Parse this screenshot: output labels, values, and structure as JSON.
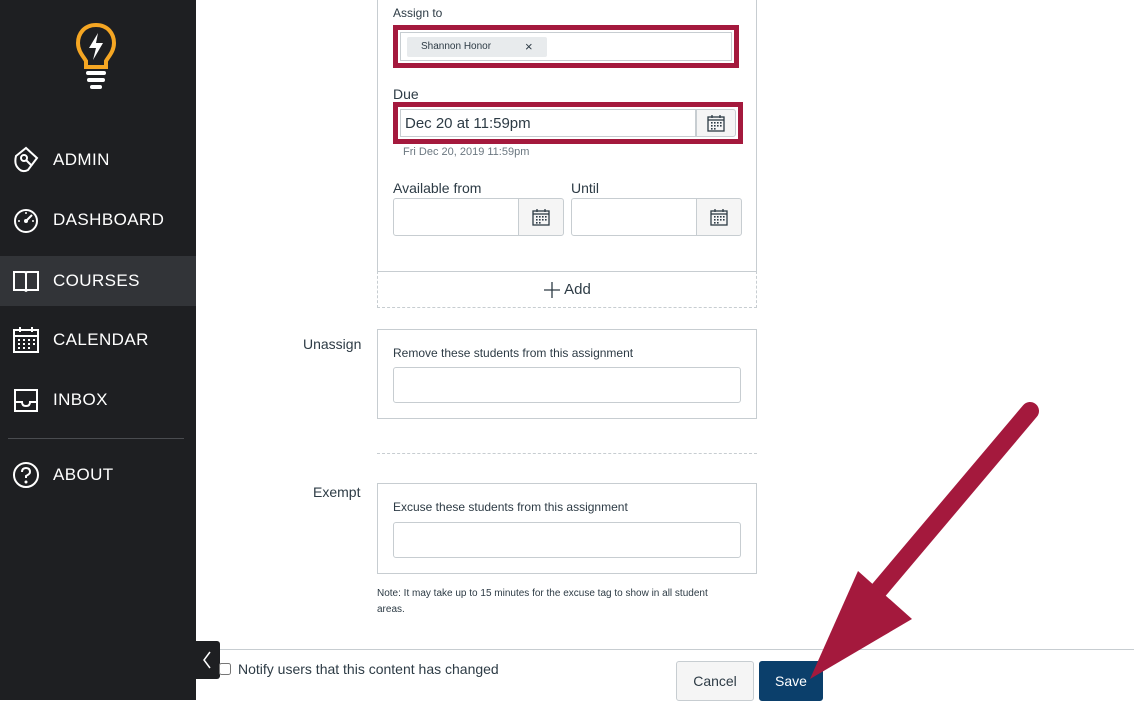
{
  "sidebar": {
    "items": [
      {
        "label": "ADMIN",
        "icon": "admin-shield-icon"
      },
      {
        "label": "DASHBOARD",
        "icon": "speedometer-icon"
      },
      {
        "label": "COURSES",
        "icon": "book-icon",
        "active": true
      },
      {
        "label": "CALENDAR",
        "icon": "calendar-icon"
      },
      {
        "label": "INBOX",
        "icon": "inbox-icon"
      },
      {
        "label": "ABOUT",
        "icon": "help-circle-icon"
      }
    ]
  },
  "assign": {
    "label": "Assign to",
    "token": "Shannon Honor",
    "token_remove": "×"
  },
  "due": {
    "label": "Due",
    "value": "Dec 20 at 11:59pm",
    "hint": "Fri Dec 20, 2019 11:59pm"
  },
  "available_from": {
    "label": "Available from",
    "value": ""
  },
  "until": {
    "label": "Until",
    "value": ""
  },
  "add_label": "Add",
  "unassign": {
    "label": "Unassign",
    "description": "Remove these students from this assignment"
  },
  "exempt": {
    "label": "Exempt",
    "description": "Excuse these students from this assignment",
    "note": "Note: It may take up to 15 minutes for the excuse tag to show in all student areas."
  },
  "notify_label": "Notify users that this content has changed",
  "buttons": {
    "cancel": "Cancel",
    "save": "Save"
  },
  "colors": {
    "sidebar_bg": "#1e1f22",
    "highlight": "#a4193d",
    "save_bg": "#0b3f6b",
    "logo": "#f5a623"
  }
}
